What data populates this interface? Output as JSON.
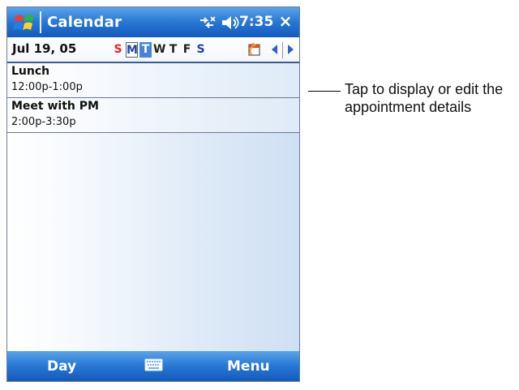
{
  "titlebar": {
    "start_icon": "windows-start-icon",
    "title": "Calendar",
    "connectivity_icon": "connectivity-icon",
    "volume_icon": "volume-icon",
    "time": "7:35",
    "close_label": "×"
  },
  "date_bar": {
    "date": "Jul 19, 05",
    "weekdays": [
      "S",
      "M",
      "T",
      "W",
      "T",
      "F",
      "S"
    ],
    "today_index": 1,
    "selected_index": 2,
    "goto_icon": "goto-today-icon",
    "prev_icon": "left-arrow-icon",
    "next_icon": "right-arrow-icon"
  },
  "appointments": [
    {
      "title": "Lunch",
      "time": "12:00p-1:00p"
    },
    {
      "title": "Meet with PM",
      "time": "2:00p-3:30p"
    }
  ],
  "bottom_bar": {
    "left_softkey": "Day",
    "keyboard_icon": "keyboard-icon",
    "right_softkey": "Menu"
  },
  "callout": {
    "text": "Tap to display or edit the appointment details"
  },
  "colors": {
    "titlebar_blue": "#2878d5",
    "selected_blue": "#4a83d9",
    "sunday_red": "#ea2328"
  }
}
